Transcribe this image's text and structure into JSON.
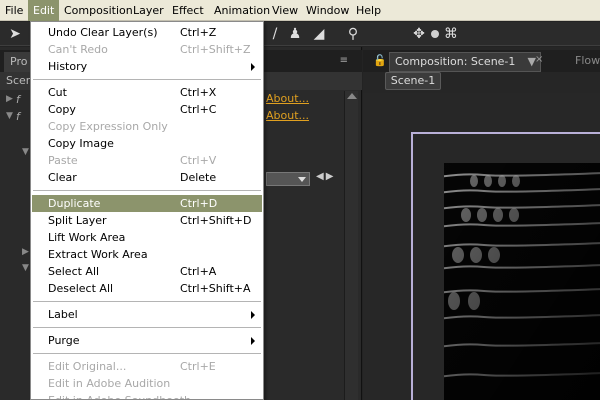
{
  "menubar": {
    "items": [
      "File",
      "Edit",
      "Composition",
      "Layer",
      "Effect",
      "Animation",
      "View",
      "Window",
      "Help"
    ],
    "active": "Edit"
  },
  "left_panel": {
    "tab_label": "Pro",
    "sub_label": "Scen",
    "row1_prefix": "f",
    "row2_prefix": "f",
    "about1": "About...",
    "about2": "About..."
  },
  "right_panel": {
    "tab_label": "Composition: Scene-1",
    "dropdown_glyph": "▼",
    "close_glyph": "×",
    "flow_label": "Flow",
    "scene_button": "Scene-1"
  },
  "edit_menu": {
    "items": [
      {
        "label": "Undo Clear Layer(s)",
        "shortcut": "Ctrl+Z",
        "enabled": true
      },
      {
        "label": "Can't Redo",
        "shortcut": "Ctrl+Shift+Z",
        "enabled": false
      },
      {
        "label": "History",
        "shortcut": "",
        "enabled": true,
        "submenu": true
      },
      {
        "label": "Cut",
        "shortcut": "Ctrl+X",
        "enabled": true
      },
      {
        "label": "Copy",
        "shortcut": "Ctrl+C",
        "enabled": true
      },
      {
        "label": "Copy Expression Only",
        "shortcut": "",
        "enabled": false
      },
      {
        "label": "Copy Image",
        "shortcut": "",
        "enabled": true
      },
      {
        "label": "Paste",
        "shortcut": "Ctrl+V",
        "enabled": false
      },
      {
        "label": "Clear",
        "shortcut": "Delete",
        "enabled": true
      },
      {
        "label": "Duplicate",
        "shortcut": "Ctrl+D",
        "enabled": true,
        "selected": true
      },
      {
        "label": "Split Layer",
        "shortcut": "Ctrl+Shift+D",
        "enabled": true
      },
      {
        "label": "Lift Work Area",
        "shortcut": "",
        "enabled": true
      },
      {
        "label": "Extract Work Area",
        "shortcut": "",
        "enabled": true
      },
      {
        "label": "Select All",
        "shortcut": "Ctrl+A",
        "enabled": true
      },
      {
        "label": "Deselect All",
        "shortcut": "Ctrl+Shift+A",
        "enabled": true
      },
      {
        "label": "Label",
        "shortcut": "",
        "enabled": true,
        "submenu": true
      },
      {
        "label": "Purge",
        "shortcut": "",
        "enabled": true,
        "submenu": true
      },
      {
        "label": "Edit Original...",
        "shortcut": "Ctrl+E",
        "enabled": false
      },
      {
        "label": "Edit in Adobe Audition",
        "shortcut": "",
        "enabled": false
      },
      {
        "label": "Edit in Adobe Soundbooth",
        "shortcut": "",
        "enabled": false
      }
    ]
  },
  "colors": {
    "menu_highlight": "#8c946c",
    "link_orange": "#e0a020",
    "comp_frame": "#b9b0d8"
  }
}
